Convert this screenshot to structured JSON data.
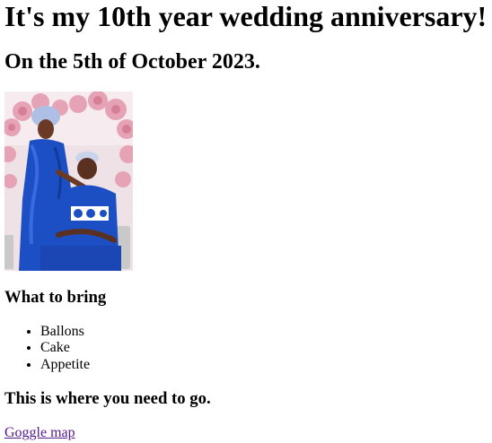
{
  "heading": "It's my 10th year wedding anniversary!",
  "date_line": "On the 5th of October 2023.",
  "photo": {
    "icon": "couple-photo",
    "colors": {
      "background": "#efe2e7",
      "flowers": "#e7a3b6",
      "outfit": "#1d4fc4"
    }
  },
  "bring": {
    "title": "What to bring",
    "items": [
      "Ballons",
      "Cake",
      "Appetite"
    ]
  },
  "destination": {
    "title": "This is where you need to go.",
    "link_label": "Goggle map"
  }
}
